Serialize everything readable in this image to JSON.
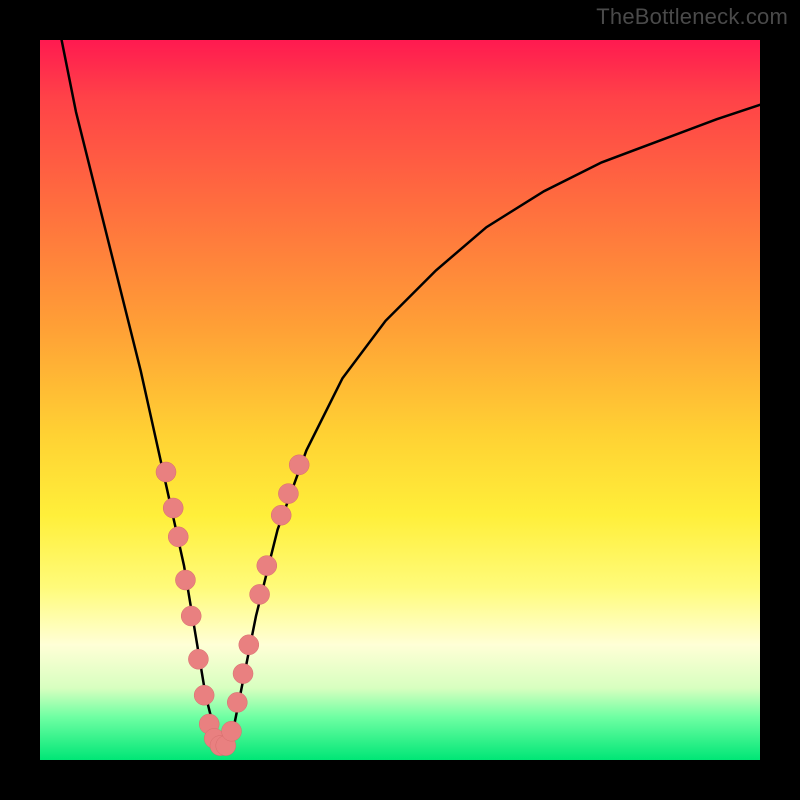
{
  "watermark": "TheBottleneck.com",
  "chart_data": {
    "type": "line",
    "title": "",
    "xlabel": "",
    "ylabel": "",
    "xlim": [
      0,
      100
    ],
    "ylim": [
      0,
      100
    ],
    "grid": false,
    "curve": {
      "name": "bottleneck-curve",
      "x": [
        3,
        5,
        8,
        11,
        14,
        16,
        18,
        20,
        21,
        22,
        23,
        24,
        25,
        26,
        27,
        28,
        30,
        33,
        37,
        42,
        48,
        55,
        62,
        70,
        78,
        86,
        94,
        100
      ],
      "values": [
        100,
        90,
        78,
        66,
        54,
        45,
        36,
        27,
        21,
        15,
        9,
        5,
        2,
        2,
        5,
        10,
        20,
        32,
        43,
        53,
        61,
        68,
        74,
        79,
        83,
        86,
        89,
        91
      ]
    },
    "markers": {
      "name": "data-points",
      "points": [
        {
          "x": 17.5,
          "y": 40
        },
        {
          "x": 18.5,
          "y": 35
        },
        {
          "x": 19.2,
          "y": 31
        },
        {
          "x": 20.2,
          "y": 25
        },
        {
          "x": 21.0,
          "y": 20
        },
        {
          "x": 22.0,
          "y": 14
        },
        {
          "x": 22.8,
          "y": 9
        },
        {
          "x": 23.5,
          "y": 5
        },
        {
          "x": 24.2,
          "y": 3
        },
        {
          "x": 25.0,
          "y": 2
        },
        {
          "x": 25.8,
          "y": 2
        },
        {
          "x": 26.6,
          "y": 4
        },
        {
          "x": 27.4,
          "y": 8
        },
        {
          "x": 28.2,
          "y": 12
        },
        {
          "x": 29.0,
          "y": 16
        },
        {
          "x": 30.5,
          "y": 23
        },
        {
          "x": 31.5,
          "y": 27
        },
        {
          "x": 33.5,
          "y": 34
        },
        {
          "x": 34.5,
          "y": 37
        },
        {
          "x": 36.0,
          "y": 41
        }
      ]
    },
    "gradient_stops": [
      {
        "pos": 0,
        "color": "#ff1a50"
      },
      {
        "pos": 8,
        "color": "#ff4248"
      },
      {
        "pos": 22,
        "color": "#ff6b3f"
      },
      {
        "pos": 40,
        "color": "#ffa036"
      },
      {
        "pos": 55,
        "color": "#ffd233"
      },
      {
        "pos": 66,
        "color": "#ffef3a"
      },
      {
        "pos": 76,
        "color": "#fffb7a"
      },
      {
        "pos": 84,
        "color": "#ffffd6"
      },
      {
        "pos": 90,
        "color": "#d8ffc0"
      },
      {
        "pos": 94,
        "color": "#6fffa3"
      },
      {
        "pos": 100,
        "color": "#00e676"
      }
    ]
  }
}
